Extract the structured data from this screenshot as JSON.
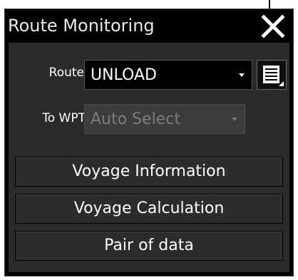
{
  "window": {
    "title": "Route Monitoring",
    "close_icon": "close-icon"
  },
  "route": {
    "label": "Route",
    "selected": "UNLOAD",
    "menu_icon": "list-menu-icon"
  },
  "to_wpt": {
    "label": "To WPT",
    "selected": "Auto Select",
    "enabled": false
  },
  "buttons": {
    "voyage_information": "Voyage Information",
    "voyage_calculation": "Voyage Calculation",
    "pair_of_data": "Pair of data"
  },
  "colors": {
    "panel_background": "#000000",
    "body_background": "#2a2a2a",
    "text": "#ffffff",
    "disabled_text": "#7c7c7c"
  }
}
